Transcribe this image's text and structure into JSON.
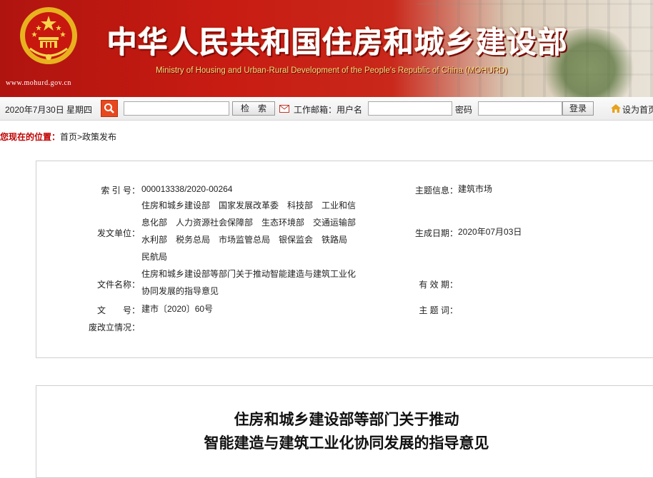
{
  "header": {
    "ministry_cn": "中华人民共和国住房和城乡建设部",
    "ministry_en": "Ministry of Housing and Urban-Rural Development of the People's Republic of China (MOHURD)",
    "site_url": "www.mohurd.gov.cn",
    "emblem_icon": "national-emblem-icon",
    "colors": {
      "banner_red": "#c81c12",
      "gold": "#f4e07a"
    }
  },
  "toolbar": {
    "date": "2020年7月30日 星期四",
    "search_button": "检　索",
    "mail_label": "工作邮箱：用户名",
    "password_label": "密码",
    "username_value": "",
    "password_value": "",
    "search_value": "",
    "login_button": "登录",
    "homepage_link": "设为首页"
  },
  "breadcrumb": {
    "prefix": "您现在的位置：",
    "items": [
      "首页",
      "政策发布"
    ],
    "separator": ">"
  },
  "meta": {
    "index_label": "索 引 号：",
    "index_value": "000013338/2020-00264",
    "topic_label": "主题信息：",
    "topic_value": "建筑市场",
    "issuer_label": "发文单位：",
    "issuer_value": "住房和城乡建设部　国家发展改革委　科技部　工业和信息化部　人力资源社会保障部　生态环境部　交通运输部　水利部　税务总局　市场监管总局　银保监会　铁路局　民航局",
    "generated_label": "生成日期：",
    "generated_value": "2020年07月03日",
    "filename_label": "文件名称：",
    "filename_value": "住房和城乡建设部等部门关于推动智能建造与建筑工业化协同发展的指导意见",
    "validity_label": "有 效 期：",
    "validity_value": "",
    "docno_label": "文　　号：",
    "docno_value": "建市〔2020〕60号",
    "subject_label": "主 题 词：",
    "subject_value": "",
    "status_label": "废改立情况：",
    "status_value": ""
  },
  "document": {
    "title_line1": "住房和城乡建设部等部门关于推动",
    "title_line2": "智能建造与建筑工业化协同发展的指导意见"
  }
}
